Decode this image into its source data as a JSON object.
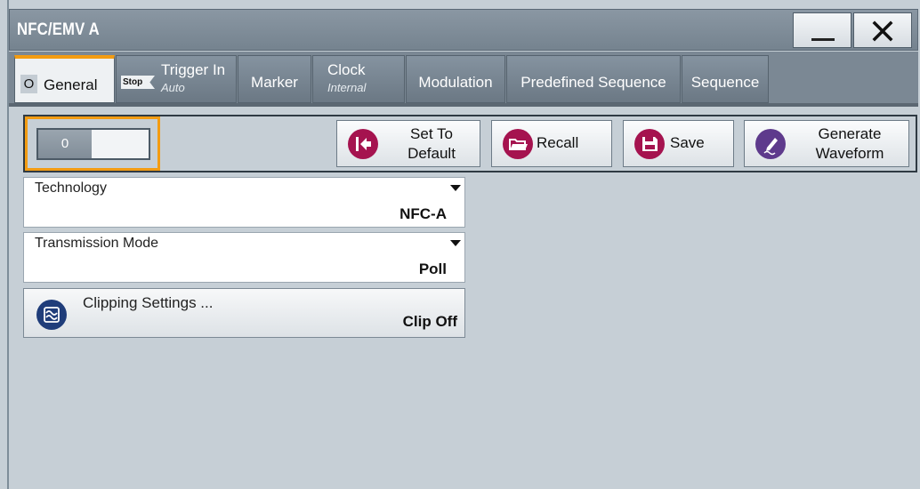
{
  "window": {
    "title": "NFC/EMV A"
  },
  "tabs": {
    "general": {
      "indicator": "O",
      "label": "General"
    },
    "trigger": {
      "badge": "Stop",
      "label": "Trigger In",
      "sub": "Auto"
    },
    "marker": {
      "label": "Marker"
    },
    "clock": {
      "label": "Clock",
      "sub": "Internal"
    },
    "modulation": {
      "label": "Modulation"
    },
    "predefined_sequence": {
      "label": "Predefined Sequence"
    },
    "sequence": {
      "label": "Sequence"
    }
  },
  "toolbar": {
    "state_value": "0",
    "set_to_default_line1": "Set To",
    "set_to_default_line2": "Default",
    "recall_label": "Recall",
    "save_label": "Save",
    "generate_line1": "Generate",
    "generate_line2": "Waveform"
  },
  "fields": {
    "technology": {
      "label": "Technology",
      "value": "NFC-A"
    },
    "transmission_mode": {
      "label": "Transmission Mode",
      "value": "Poll"
    },
    "clipping": {
      "label": "Clipping Settings ...",
      "value": "Clip Off"
    }
  },
  "colors": {
    "accent_orange": "#f39c12",
    "action_icon_red": "#a5134f",
    "generate_icon_purple": "#5e3a8c",
    "clipping_icon_blue": "#1f3d7a"
  },
  "icons": {
    "minimize": "minimize-icon",
    "close": "close-icon",
    "set_to_default": "arrow-left-bar-icon",
    "recall": "folder-open-icon",
    "save": "floppy-disk-icon",
    "generate": "pen-wave-icon",
    "clipping": "clipping-wave-icon"
  }
}
